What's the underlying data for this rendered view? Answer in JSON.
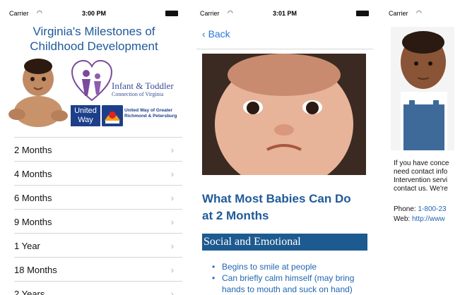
{
  "screens": [
    {
      "status": {
        "carrier": "Carrier",
        "time": "3:00 PM"
      },
      "title_lines": [
        "Virginia's Milestones of",
        "Childhood Development"
      ],
      "logos": {
        "itc_name": "Infant & Toddler",
        "itc_sub": "Connection of Virginia",
        "uw_name_lines": [
          "United",
          "Way"
        ],
        "uw_caption_lines": [
          "United Way of Greater",
          "Richmond & Petersburg"
        ]
      },
      "menu_items": [
        "2 Months",
        "4 Months",
        "6 Months",
        "9 Months",
        "1 Year",
        "18 Months",
        "2 Years"
      ]
    },
    {
      "status": {
        "carrier": "Carrier",
        "time": "3:01 PM"
      },
      "back_label": "Back",
      "heading_lines": [
        "What Most Babies Can Do",
        "at 2 Months"
      ],
      "section_band": "Social and Emotional",
      "bullets": [
        "Begins to smile at people",
        "Can briefly calm himself (may bring hands to mouth and suck on hand)"
      ]
    },
    {
      "status": {
        "carrier": "Carrier"
      },
      "body_lines": [
        "If you have conce",
        "need contact info",
        "Intervention servi",
        "contact us. We're"
      ],
      "phone_label": "Phone:",
      "phone_value": "1-800-23",
      "web_label": "Web:",
      "web_value": "http://www"
    }
  ],
  "colors": {
    "title_blue": "#1f5a9a",
    "link_blue": "#2979d8",
    "band_blue": "#1d5a8f"
  },
  "icons": [
    "wifi-icon",
    "battery-icon",
    "chevron-right-icon",
    "back-chevron-icon"
  ]
}
